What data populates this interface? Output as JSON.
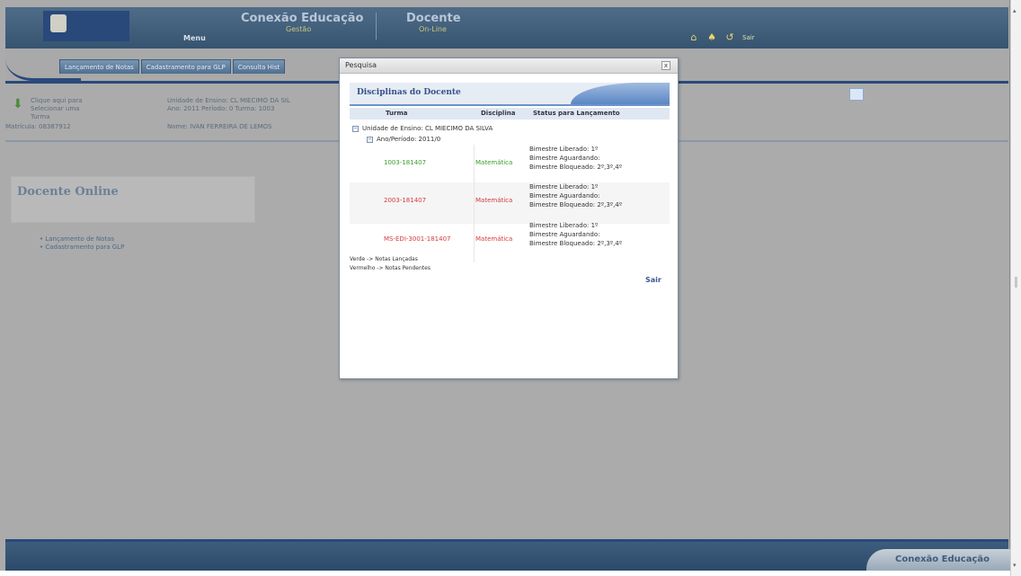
{
  "colors": {
    "header_bg": "#3f5f7d",
    "accent_navy": "#29497a",
    "page_bg": "#ababab",
    "turma_green": "#3c9b2e",
    "turma_red": "#d43c3c",
    "link_blue": "#3a5a92"
  },
  "header": {
    "brand": "Conexão Educação",
    "brand_sub": "Gestão",
    "module": "Docente",
    "module_sub": "On-Line",
    "menu_label": "Menu",
    "icons": [
      "home-icon",
      "bell-icon",
      "exit-icon"
    ],
    "sair_label": "Sair"
  },
  "tabs": [
    "Lançamento de Notas",
    "Cadastramento para GLP",
    "Consulta Hist"
  ],
  "info": {
    "select_text": "Clique aqui para Selecionar uma Turma",
    "unidade": "Unidade de Ensino: CL MIECIMO DA SIL",
    "ano": "Ano: 2011 Período: 0 Turma: 1003",
    "matricula": "Matrícula: 08387912",
    "nome": "Nome: IVAN FERREIRA DE LEMOS"
  },
  "left": {
    "docente_title": "Docente Online",
    "links": [
      "Lançamento de Notas",
      "Cadastramento para GLP"
    ]
  },
  "modal": {
    "title": "Pesquisa",
    "close": "x",
    "panel_title": "Disciplinas do Docente",
    "columns": {
      "turma": "Turma",
      "disciplina": "Disciplina",
      "status": "Status para Lançamento"
    },
    "unidade_label": "Unidade de Ensino: CL MIECIMO DA SILVA",
    "ano_label": "Ano/Período: 2011/0",
    "rows": [
      {
        "turma": "1003-181407",
        "turma_color": "#3c9b2e",
        "disciplina": "Matemática",
        "disciplina_color": "#3c9b2e",
        "status": [
          "Bimestre Liberado: 1º",
          "Bimestre Aguardando:",
          "Bimestre Bloqueado: 2º,3º,4º"
        ]
      },
      {
        "turma": "2003-181407",
        "turma_color": "#d43c3c",
        "disciplina": "Matemática",
        "disciplina_color": "#d43c3c",
        "status": [
          "Bimestre Liberado: 1º",
          "Bimestre Aguardando:",
          "Bimestre Bloqueado: 2º,3º,4º"
        ]
      },
      {
        "turma": "MS-EDI-3001-181407",
        "turma_color": "#d43c3c",
        "disciplina": "Matemática",
        "disciplina_color": "#d43c3c",
        "status": [
          "Bimestre Liberado: 1º",
          "Bimestre Aguardando:",
          "Bimestre Bloqueado: 2º,3º,4º"
        ]
      }
    ],
    "legend_verde": "Verde -> Notas Lançadas",
    "legend_vermelho": "Vermelho -> Notas Pendentes",
    "sair": "Sair"
  }
}
